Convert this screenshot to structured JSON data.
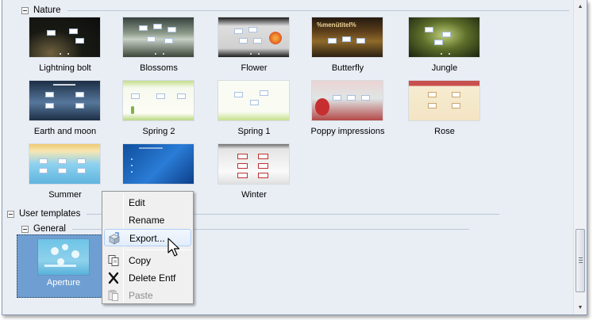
{
  "groups": {
    "nature": {
      "label": "Nature"
    },
    "user_templates": {
      "label": "User templates"
    },
    "general": {
      "label": "General"
    }
  },
  "templates": {
    "nature": [
      {
        "label": "Lightning bolt",
        "thumb_icon": "lightning-bolt-thumbnail"
      },
      {
        "label": "Blossoms",
        "thumb_icon": "blossoms-thumbnail"
      },
      {
        "label": "Flower",
        "thumb_icon": "flower-thumbnail"
      },
      {
        "label": "Butterfly",
        "thumb_icon": "butterfly-thumbnail",
        "thumb_text": "%menütitel%"
      },
      {
        "label": "Jungle",
        "thumb_icon": "jungle-thumbnail"
      },
      {
        "label": "Earth and moon",
        "thumb_icon": "earth-and-moon-thumbnail"
      },
      {
        "label": "Spring 2",
        "thumb_icon": "spring-2-thumbnail"
      },
      {
        "label": "Spring 1",
        "thumb_icon": "spring-1-thumbnail"
      },
      {
        "label": "Poppy impressions",
        "thumb_icon": "poppy-impressions-thumbnail"
      },
      {
        "label": "Rose",
        "thumb_icon": "rose-thumbnail"
      },
      {
        "label": "Summer",
        "thumb_icon": "summer-thumbnail"
      },
      {
        "label": "",
        "thumb_icon": "blue-aero-thumbnail"
      },
      {
        "label": "Winter",
        "thumb_icon": "winter-thumbnail"
      }
    ],
    "general": [
      {
        "label": "Aperture",
        "thumb_icon": "aperture-thumbnail",
        "selected": true
      }
    ]
  },
  "context_menu": {
    "items": [
      {
        "label": "Edit",
        "icon": null,
        "enabled": true,
        "highlighted": false
      },
      {
        "label": "Rename",
        "icon": null,
        "enabled": true,
        "highlighted": false
      },
      {
        "label": "Export...",
        "icon": "export-box-icon",
        "enabled": true,
        "highlighted": true
      },
      {
        "label": "Copy",
        "icon": "copy-icon",
        "enabled": true,
        "highlighted": false
      },
      {
        "label": "Delete Entf",
        "icon": "delete-x-icon",
        "enabled": true,
        "highlighted": false
      },
      {
        "label": "Paste",
        "icon": "paste-icon",
        "enabled": false,
        "highlighted": false
      }
    ]
  },
  "colors": {
    "panel_bg": "#e9eef5",
    "selection": "#6f9fd2",
    "menu_bg": "#f0f0f0",
    "menu_hover": "#e2edfb"
  }
}
